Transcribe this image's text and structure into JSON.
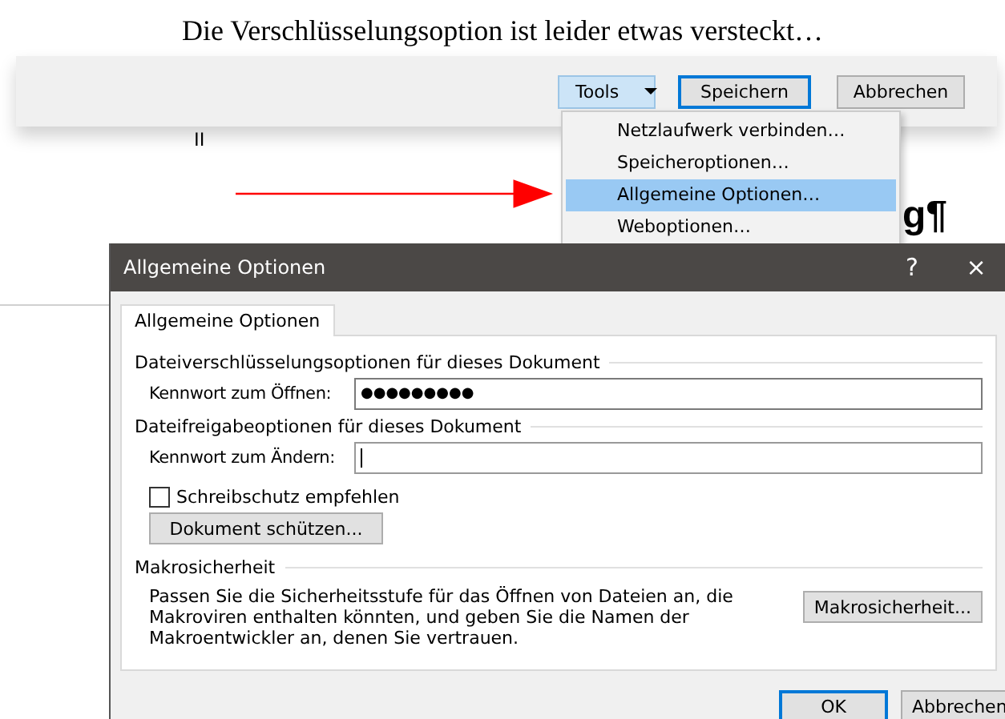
{
  "caption": "Die Verschlüsselungsoption ist leider etwas versteckt…",
  "save_dialog": {
    "buttons": [
      {
        "label": "Tools",
        "kind": "dropdown",
        "selected": true
      },
      {
        "label": "Speichern",
        "kind": "default",
        "selected": false
      },
      {
        "label": "Abbrechen",
        "kind": "plain",
        "selected": false
      }
    ]
  },
  "tools_menu": {
    "items": [
      {
        "label": "Netzlaufwerk verbinden…",
        "selected": false
      },
      {
        "label": "Speicheroptionen…",
        "selected": false
      },
      {
        "label": "Allgemeine Optionen…",
        "selected": true
      },
      {
        "label": "Weboptionen…",
        "selected": false
      }
    ]
  },
  "document": {
    "fragments": [
      "II",
      "g¶"
    ]
  },
  "dialog": {
    "title": "Allgemeine Optionen",
    "title_buttons": [
      "?",
      "×"
    ],
    "tabs": [
      {
        "label": "Allgemeine Optionen",
        "selected": true
      }
    ],
    "sections": [
      {
        "heading": "Dateiverschlüsselungsoptionen für dieses Dokument",
        "fields": [
          {
            "label": "Kennwort zum Öffnen:",
            "value": "●●●●●●●●●",
            "focused": false
          }
        ]
      },
      {
        "heading": "Dateifreigabeoptionen für dieses Dokument",
        "fields": [
          {
            "label": "Kennwort zum Ändern:",
            "focused": true
          }
        ],
        "checkbox": {
          "label": "Schreibschutz empfehlen",
          "checked": false
        },
        "button": "Dokument schützen..."
      },
      {
        "heading": "Makrosicherheit",
        "text": "Passen Sie die Sicherheitsstufe für das Öffnen von Dateien an, die Makroviren enthalten könnten, und geben Sie die Namen der Makroentwickler an, denen Sie vertrauen.",
        "button": "Makrosicherheit..."
      }
    ],
    "buttons": [
      {
        "label": "OK",
        "kind": "default"
      },
      {
        "label": "Abbrechen",
        "kind": "plain"
      }
    ]
  }
}
